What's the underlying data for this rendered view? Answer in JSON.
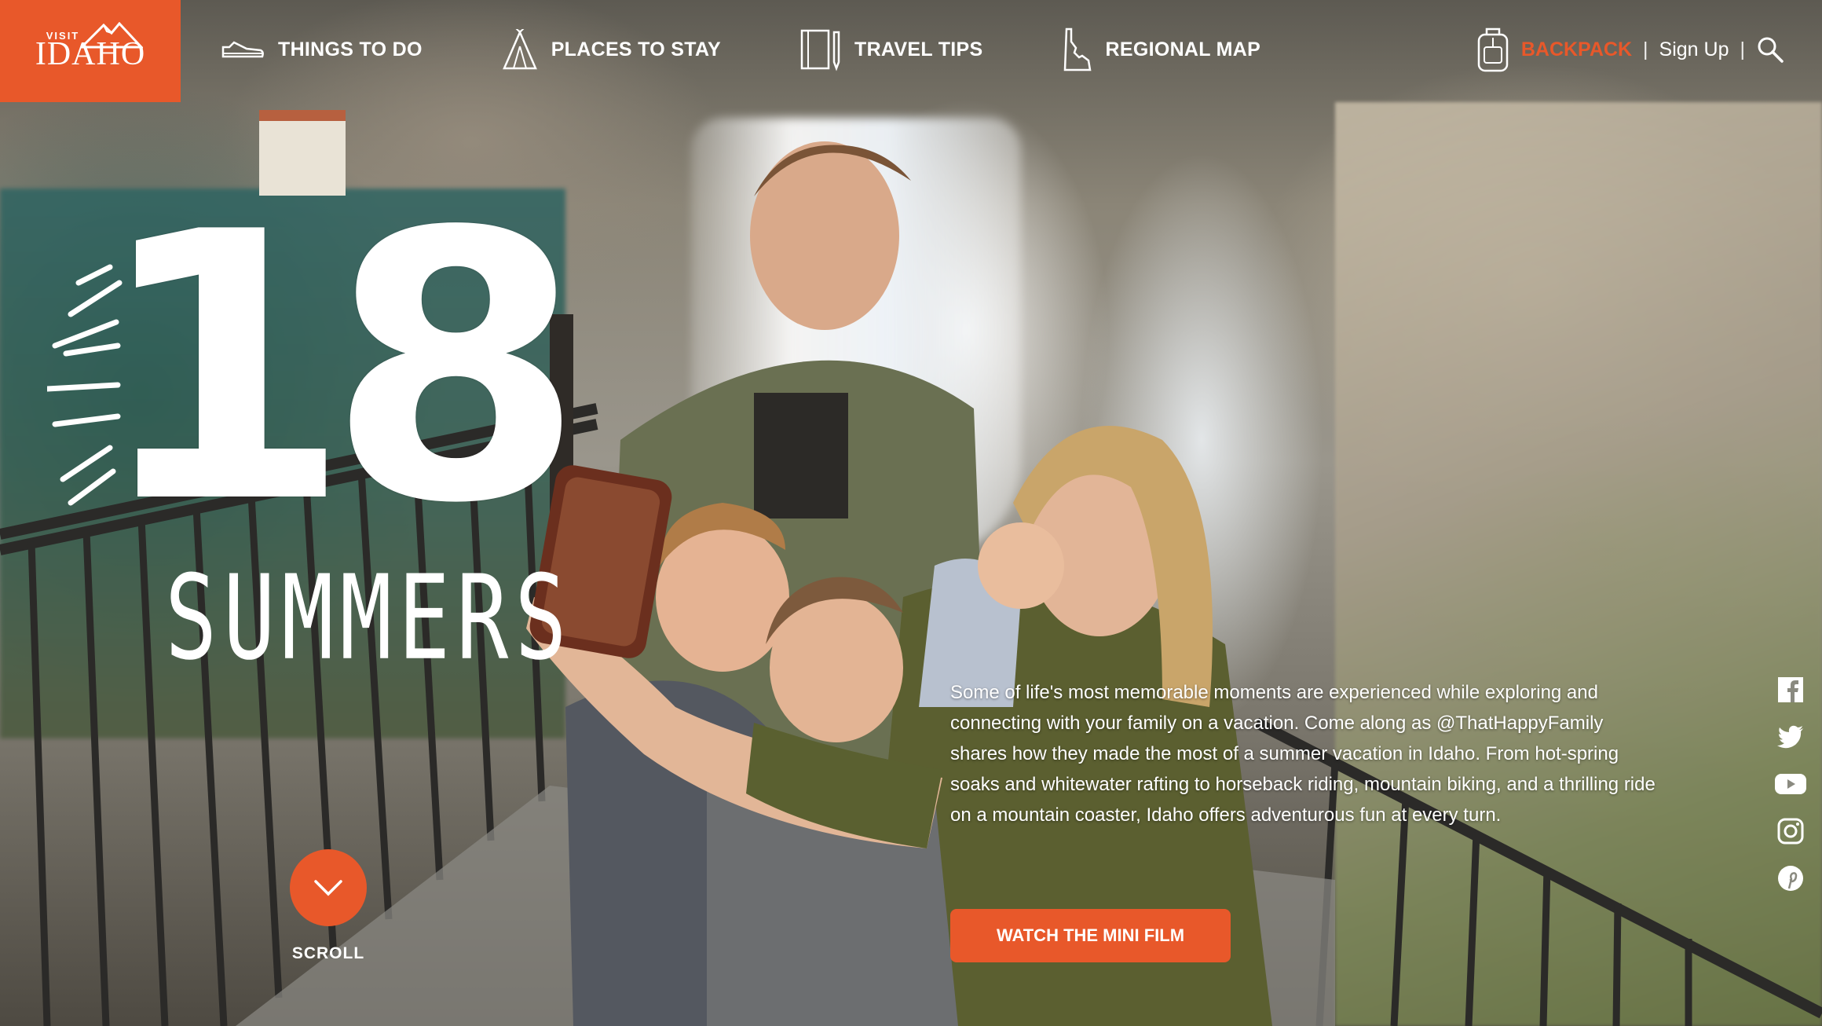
{
  "brand": {
    "visit": "VISIT",
    "name": "IDAHO",
    "accent": "#e8582a"
  },
  "nav": {
    "items": [
      {
        "label": "THINGS TO DO",
        "icon": "shoe-icon"
      },
      {
        "label": "PLACES TO STAY",
        "icon": "tent-icon"
      },
      {
        "label": "TRAVEL TIPS",
        "icon": "notebook-pencil-icon"
      },
      {
        "label": "REGIONAL MAP",
        "icon": "idaho-map-icon"
      }
    ]
  },
  "utility": {
    "backpack": "BACKPACK",
    "separator": "|",
    "signup": "Sign Up",
    "search_icon": "search-icon",
    "backpack_icon": "backpack-icon"
  },
  "hero": {
    "title_number": "18",
    "title_word": "SUMMERS",
    "intro": "Some of life's most memorable moments are experienced while exploring and connecting with your family on a vacation. Come along as @ThatHappyFamily shares how they made the most of a summer vacation in Idaho. From hot-spring soaks and whitewater rafting to horseback riding, mountain biking, and a thrilling ride on a mountain coaster, Idaho offers adventurous fun at every turn.",
    "cta": "WATCH THE MINI FILM"
  },
  "scroll": {
    "label": "SCROLL"
  },
  "social": [
    "facebook-icon",
    "twitter-icon",
    "youtube-icon",
    "instagram-icon",
    "pinterest-icon"
  ]
}
